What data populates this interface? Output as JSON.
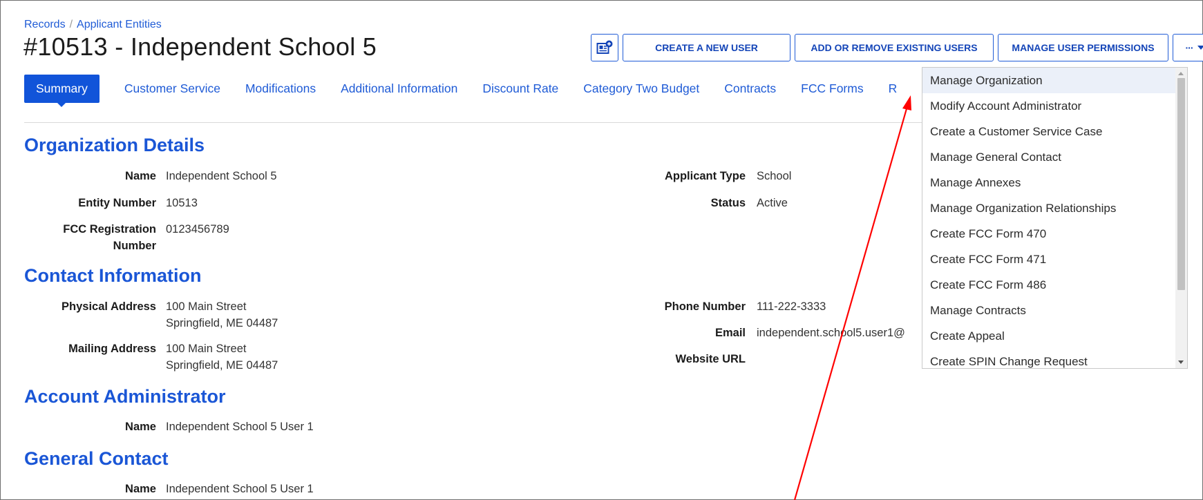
{
  "breadcrumb": {
    "items": [
      "Records",
      "Applicant Entities"
    ],
    "separator": "/"
  },
  "page_title": "#10513 - Independent School 5",
  "toolbar": {
    "icon_button": "news-plus-icon",
    "create_user": "CREATE A NEW USER",
    "add_remove_users": "ADD OR REMOVE EXISTING USERS",
    "manage_permissions": "MANAGE USER PERMISSIONS",
    "more": "···"
  },
  "tabs": [
    {
      "label": "Summary",
      "active": true
    },
    {
      "label": "Customer Service"
    },
    {
      "label": "Modifications"
    },
    {
      "label": "Additional Information"
    },
    {
      "label": "Discount Rate"
    },
    {
      "label": "Category Two Budget"
    },
    {
      "label": "Contracts"
    },
    {
      "label": "FCC Forms"
    },
    {
      "label": "R"
    }
  ],
  "sections": {
    "org_details": {
      "title": "Organization Details",
      "name_label": "Name",
      "name_value": "Independent School 5",
      "entity_label": "Entity Number",
      "entity_value": "10513",
      "fcc_label_1": "FCC Registration",
      "fcc_label_2": "Number",
      "fcc_value": "0123456789",
      "applicant_type_label": "Applicant Type",
      "applicant_type_value": "School",
      "status_label": "Status",
      "status_value": "Active"
    },
    "contact": {
      "title": "Contact Information",
      "physical_label": "Physical Address",
      "physical_line1": "100 Main Street",
      "physical_line2": "Springfield, ME 04487",
      "mailing_label": "Mailing Address",
      "mailing_line1": "100 Main Street",
      "mailing_line2": "Springfield, ME 04487",
      "phone_label": "Phone Number",
      "phone_value": "111-222-3333",
      "email_label": "Email",
      "email_value": "independent.school5.user1@",
      "website_label": "Website URL"
    },
    "account_admin": {
      "title": "Account Administrator",
      "name_label": "Name",
      "name_value": "Independent School 5 User 1"
    },
    "general_contact": {
      "title": "General Contact",
      "name_label": "Name",
      "name_value": "Independent School 5 User 1"
    }
  },
  "dropdown_menu": [
    "Manage Organization",
    "Modify Account Administrator",
    "Create a Customer Service Case",
    "Manage General Contact",
    "Manage Annexes",
    "Manage Organization Relationships",
    "Create FCC Form 470",
    "Create FCC Form 471",
    "Create FCC Form 486",
    "Manage Contracts",
    "Create Appeal",
    "Create SPIN Change Request"
  ],
  "colors": {
    "accent": "#1154d9",
    "link": "#1f5bd6",
    "heading": "#1a56d6",
    "annotation_arrow": "#ff0000"
  }
}
